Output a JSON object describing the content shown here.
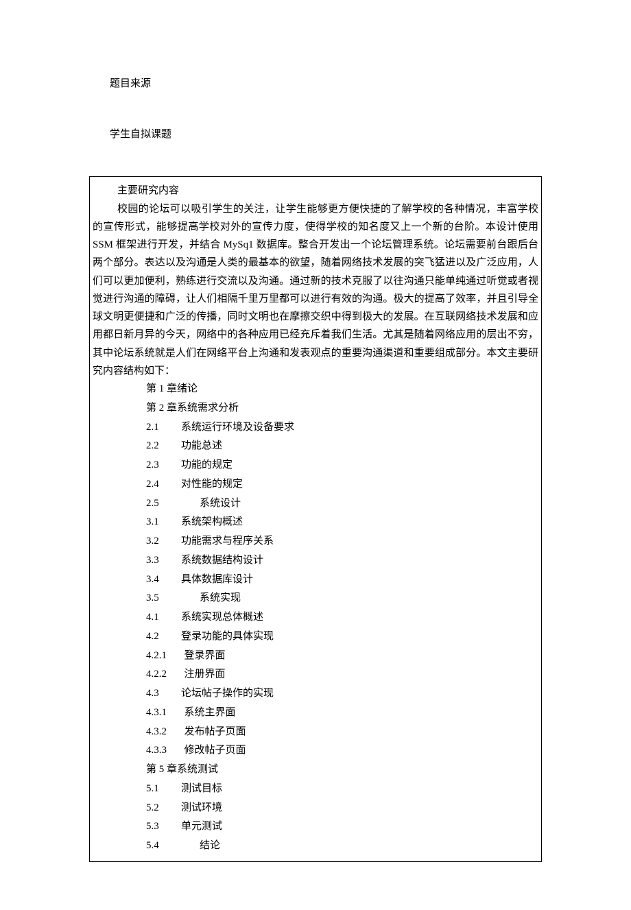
{
  "header": {
    "label_source": "题目来源",
    "label_topic": "学生自拟课题"
  },
  "research": {
    "title": "主要研究内容",
    "intro": "校园的论坛可以吸引学生的关注，让学生能够更方便快捷的了解学校的各种情况，丰富学校的宣传形式，能够提高学校对外的宣传力度，使得学校的知名度又上一个新的台阶。本设计使用 SSM 框架进行开发，并结合 MySq1 数据库。整合开发出一个论坛管理系统。论坛需要前台跟后台两个部分。表达以及沟通是人类的最基本的欲望，随着网络技术发展的突飞猛进以及广泛应用，人们可以更加便利，熟练进行交流以及沟通。通过新的技术克服了以往沟通只能单纯通过听觉或者视觉进行沟通的障碍，让人们相隔千里万里都可以进行有效的沟通。极大的提高了效率，并且引导全球文明更便捷和广泛的传播，同时文明也在摩擦交织中得到极大的发展。在互联网络技术发展和应用都日新月异的今天，网络中的各种应用已经充斥着我们生活。尤其是随着网络应用的层出不穷，其中论坛系统就是人们在网络平台上沟通和发表观点的重要沟通渠道和重要组成部分。本文主要研究内容结构如下：",
    "toc": [
      {
        "text": "第 1 章绪论"
      },
      {
        "text": "第 2 章系统需求分析"
      },
      {
        "num": "2.1",
        "text": "系统运行环境及设备要求",
        "cls": "num-gap"
      },
      {
        "num": "2.2",
        "text": "功能总述",
        "cls": "num-gap"
      },
      {
        "num": "2.3",
        "text": "功能的规定",
        "cls": "num-gap"
      },
      {
        "num": "2.4",
        "text": "对性能的规定",
        "cls": "num-gap"
      },
      {
        "num": "2.5",
        "text": "系统设计",
        "cls": "num-gap-wide"
      },
      {
        "num": "3.1",
        "text": "系统架构概述",
        "cls": "num-gap"
      },
      {
        "num": "3.2",
        "text": "功能需求与程序关系",
        "cls": "num-gap"
      },
      {
        "num": "3.3",
        "text": "系统数据结构设计",
        "cls": "num-gap"
      },
      {
        "num": "3.4",
        "text": "具体数据库设计",
        "cls": "num-gap"
      },
      {
        "num": "3.5",
        "text": "系统实现",
        "cls": "num-gap-wide"
      },
      {
        "num": "4.1",
        "text": "系统实现总体概述",
        "cls": "num-gap"
      },
      {
        "num": "4.2",
        "text": "登录功能的具体实现",
        "cls": "num-gap"
      },
      {
        "num": "4.2.1",
        "text": "登录界面",
        "cls": "num-gap-sub"
      },
      {
        "num": "4.2.2",
        "text": "注册界面",
        "cls": "num-gap-sub"
      },
      {
        "num": "4.3",
        "text": "论坛帖子操作的实现",
        "cls": "num-gap"
      },
      {
        "num": "4.3.1",
        "text": "系统主界面",
        "cls": "num-gap-sub"
      },
      {
        "num": "4.3.2",
        "text": "发布帖子页面",
        "cls": "num-gap-sub"
      },
      {
        "num": "4.3.3",
        "text": "修改帖子页面",
        "cls": "num-gap-sub"
      },
      {
        "text": "第 5 章系统测试"
      },
      {
        "num": "5.1",
        "text": "测试目标",
        "cls": "num-gap"
      },
      {
        "num": "5.2",
        "text": "测试环境",
        "cls": "num-gap"
      },
      {
        "num": "5.3",
        "text": "单元测试",
        "cls": "num-gap"
      },
      {
        "num": "5.4",
        "text": "结论",
        "cls": "num-gap-wide"
      }
    ]
  }
}
